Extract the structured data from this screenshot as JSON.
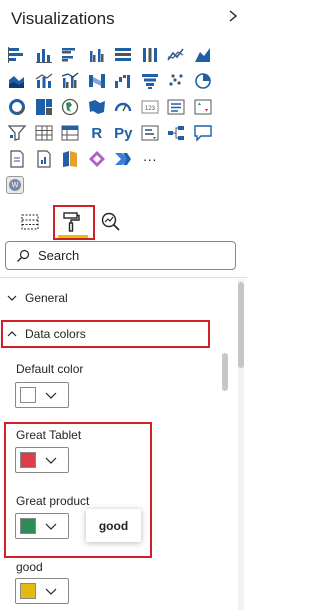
{
  "pane": {
    "title": "Visualizations"
  },
  "search": {
    "placeholder": "Search"
  },
  "sections": {
    "general": "General",
    "data_colors": "Data colors"
  },
  "colors": [
    {
      "label": "Default color",
      "swatch": "#ffffff"
    },
    {
      "label": "Great Tablet",
      "swatch": "#d9404a"
    },
    {
      "label": "Great product",
      "swatch": "#2e8b57"
    },
    {
      "label": "good",
      "swatch": "#e3b810"
    }
  ],
  "tooltip": {
    "text": "good"
  },
  "viz_text_icons": {
    "r": "R",
    "py": "Py",
    "more": "···",
    "kpi": "123"
  },
  "custom_visual": {
    "letter": "W"
  },
  "accent": {
    "highlight": "#d0212a",
    "active_tab": "#e8c200",
    "icon_blue": "#1f5fa8"
  }
}
